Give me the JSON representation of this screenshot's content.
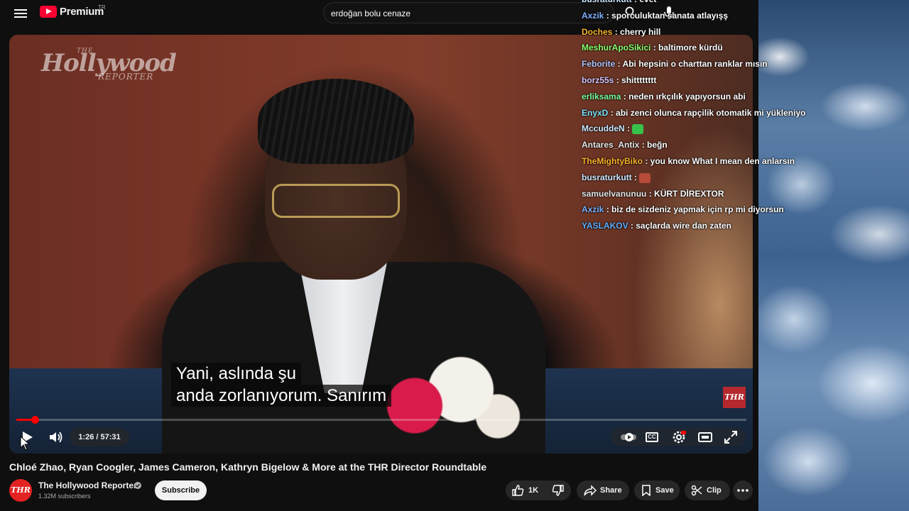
{
  "header": {
    "logo_text": "Premium",
    "logo_region": "TR",
    "search_value": "erdoğan bolu cenaze"
  },
  "video": {
    "watermark_small": "THE",
    "watermark_big": "Hollywood",
    "watermark_sub": "REPORTER",
    "corner_logo": "THR",
    "subtitle_line1": "Yani, aslında şu",
    "subtitle_line2": "anda zorlanıyorum.  Sanırım",
    "current_time": "1:26",
    "duration": "57:31",
    "time_display": "1:26 / 57:31",
    "progress": 0.025,
    "cc_label": "CC"
  },
  "chat": [
    {
      "user": "busraturkutt",
      "msg": "evet",
      "color": "#cfe8ff"
    },
    {
      "user": "Axzik",
      "msg": "sporculuktan sanata atlayışş",
      "color": "#7fb2ff"
    },
    {
      "user": "Doches",
      "msg": "cherry hill",
      "color": "#ffb42a"
    },
    {
      "user": "MeshurApoSikici",
      "msg": "baltimore kürdü",
      "color": "#8bff6a"
    },
    {
      "user": "Feborite",
      "msg": "Abi hepsini o charttan ranklar mısın",
      "color": "#b5c8ff"
    },
    {
      "user": "borz55s",
      "msg": "shitttttttt",
      "color": "#d6c7ff"
    },
    {
      "user": "erliksama",
      "msg": "neden ırkçılık yapıyorsun abi",
      "color": "#7dff9a"
    },
    {
      "user": "EnyxD",
      "msg": "abi zenci olunca rapçilik otomatik mi yükleniyo",
      "color": "#7fe3ff"
    },
    {
      "user": "MccuddeN",
      "msg": "",
      "color": "#cfe8ff",
      "emote": "#36c24a"
    },
    {
      "user": "Antares_Antix",
      "msg": "beğn",
      "color": "#e8e8e8"
    },
    {
      "user": "TheMightyBiko",
      "msg": "you know What I mean den anlarsın",
      "color": "#ffb42a"
    },
    {
      "user": "busraturkutt",
      "msg": "",
      "color": "#cfe8ff",
      "emote": "#b84a3a"
    },
    {
      "user": "samuelvanunuu",
      "msg": "KÜRT DİREXTOR",
      "color": "#e8e8e8"
    },
    {
      "user": "Axzik",
      "msg": "biz de sizdeniz yapmak için rp mi diyorsun",
      "color": "#7fb2ff"
    },
    {
      "user": "YASLAKOV",
      "msg": "saçlarda wire dan zaten",
      "color": "#5fb0ff"
    }
  ],
  "below": {
    "title": "Chloé Zhao, Ryan Coogler, James Cameron, Kathryn Bigelow & More at the THR Director Roundtable",
    "channel_avatar": "THR",
    "channel_name": "The Hollywood Reporter",
    "subscribers": "1.32M subscribers",
    "subscribe_label": "Subscribe",
    "likes": "1K",
    "share_label": "Share",
    "save_label": "Save",
    "clip_label": "Clip"
  }
}
